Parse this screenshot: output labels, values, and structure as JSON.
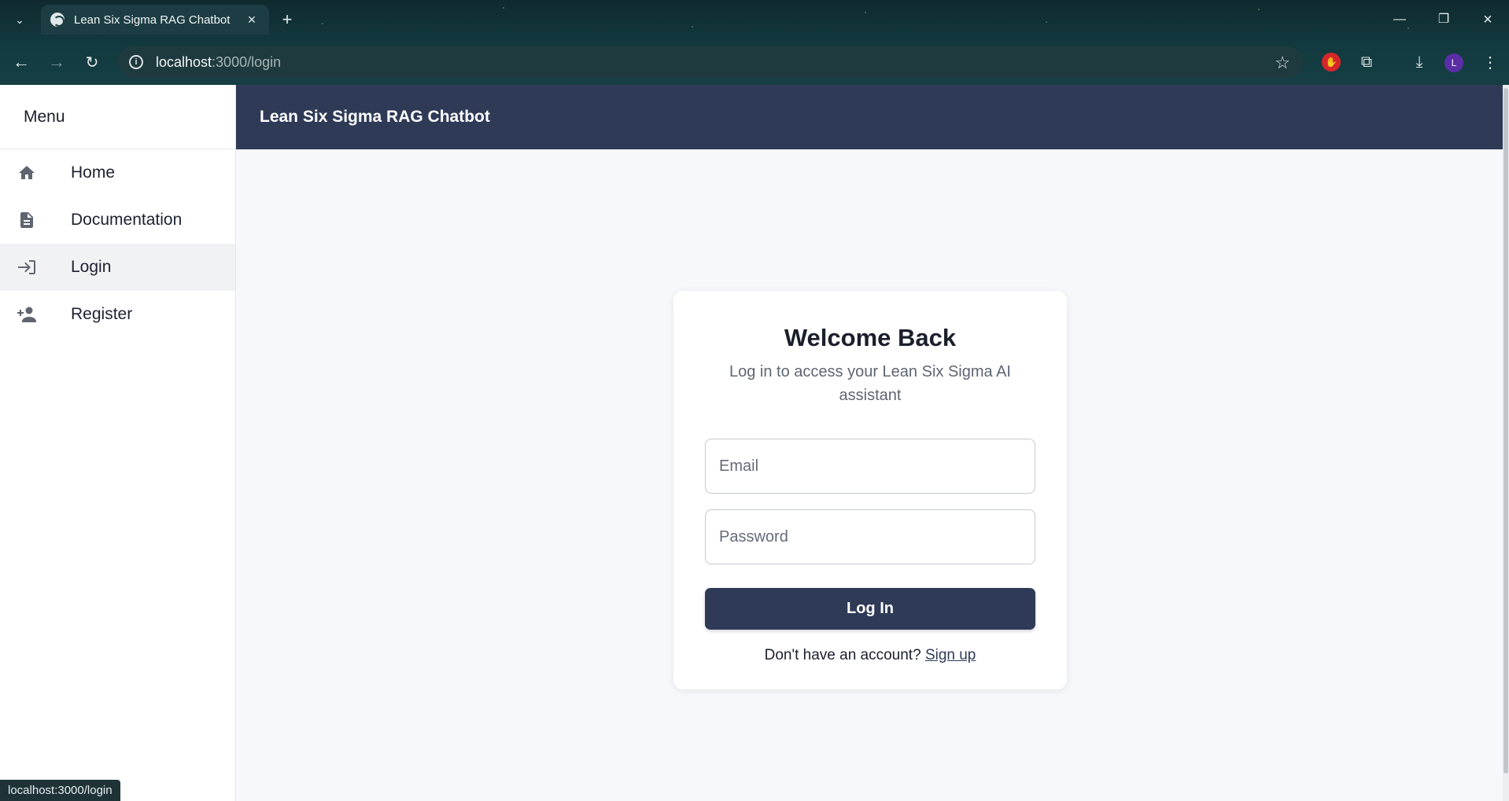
{
  "browser": {
    "tab_title": "Lean Six Sigma RAG Chatbot",
    "url_host": "localhost",
    "url_path": ":3000/login",
    "avatar_letter": "L",
    "status_url": "localhost:3000/login"
  },
  "sidebar": {
    "header": "Menu",
    "items": [
      {
        "label": "Home",
        "icon": "home-icon",
        "active": false
      },
      {
        "label": "Documentation",
        "icon": "document-icon",
        "active": false
      },
      {
        "label": "Login",
        "icon": "login-icon",
        "active": true
      },
      {
        "label": "Register",
        "icon": "person-add-icon",
        "active": false
      }
    ]
  },
  "topbar": {
    "title": "Lean Six Sigma RAG Chatbot"
  },
  "login": {
    "title": "Welcome Back",
    "subtitle": "Log in to access your Lean Six Sigma AI assistant",
    "email_placeholder": "Email",
    "password_placeholder": "Password",
    "submit_label": "Log In",
    "signup_prompt": "Don't have an account?",
    "signup_link": "Sign up"
  },
  "colors": {
    "primary": "#2e3a56",
    "page_background": "#f6f8fb",
    "active_nav_background": "#f1f2f4"
  }
}
